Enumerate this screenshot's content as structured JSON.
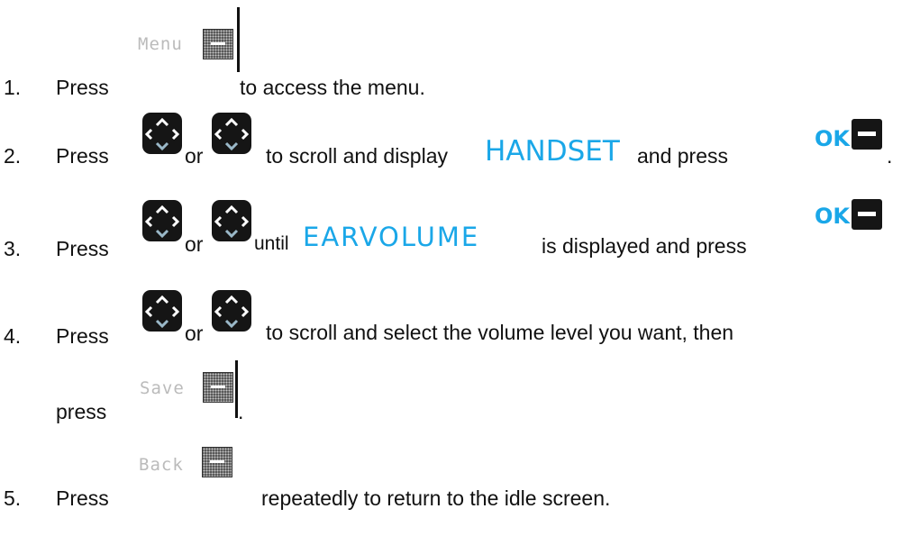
{
  "steps": [
    {
      "number": "1.",
      "press": "Press",
      "lcd_label": "Menu",
      "text": "to access the menu."
    },
    {
      "number": "2.",
      "press": "Press",
      "or": "or",
      "text_a": "to scroll and display",
      "display_word": "HANDSET",
      "text_b": "and press",
      "ok_label": "OK",
      "end": "."
    },
    {
      "number": "3.",
      "press": "Press",
      "or": "or",
      "text_a": "until",
      "display_word": "EARVOLUME",
      "text_b": "is displayed and press",
      "ok_label": "OK"
    },
    {
      "number": "4.",
      "press": "Press",
      "or": "or",
      "text": "to scroll and select the volume level you want, then",
      "press2": "press",
      "lcd_label": "Save",
      "end": "."
    },
    {
      "number": "5.",
      "press": "Press",
      "lcd_label": "Back",
      "text": "repeatedly to return to the idle screen."
    }
  ],
  "colors": {
    "accent": "#1aa7e8",
    "key": "#151515"
  },
  "icons": {
    "softkey": "softkey-icon",
    "navigation": "navigation-key-icon",
    "ok": "ok-key-icon"
  }
}
